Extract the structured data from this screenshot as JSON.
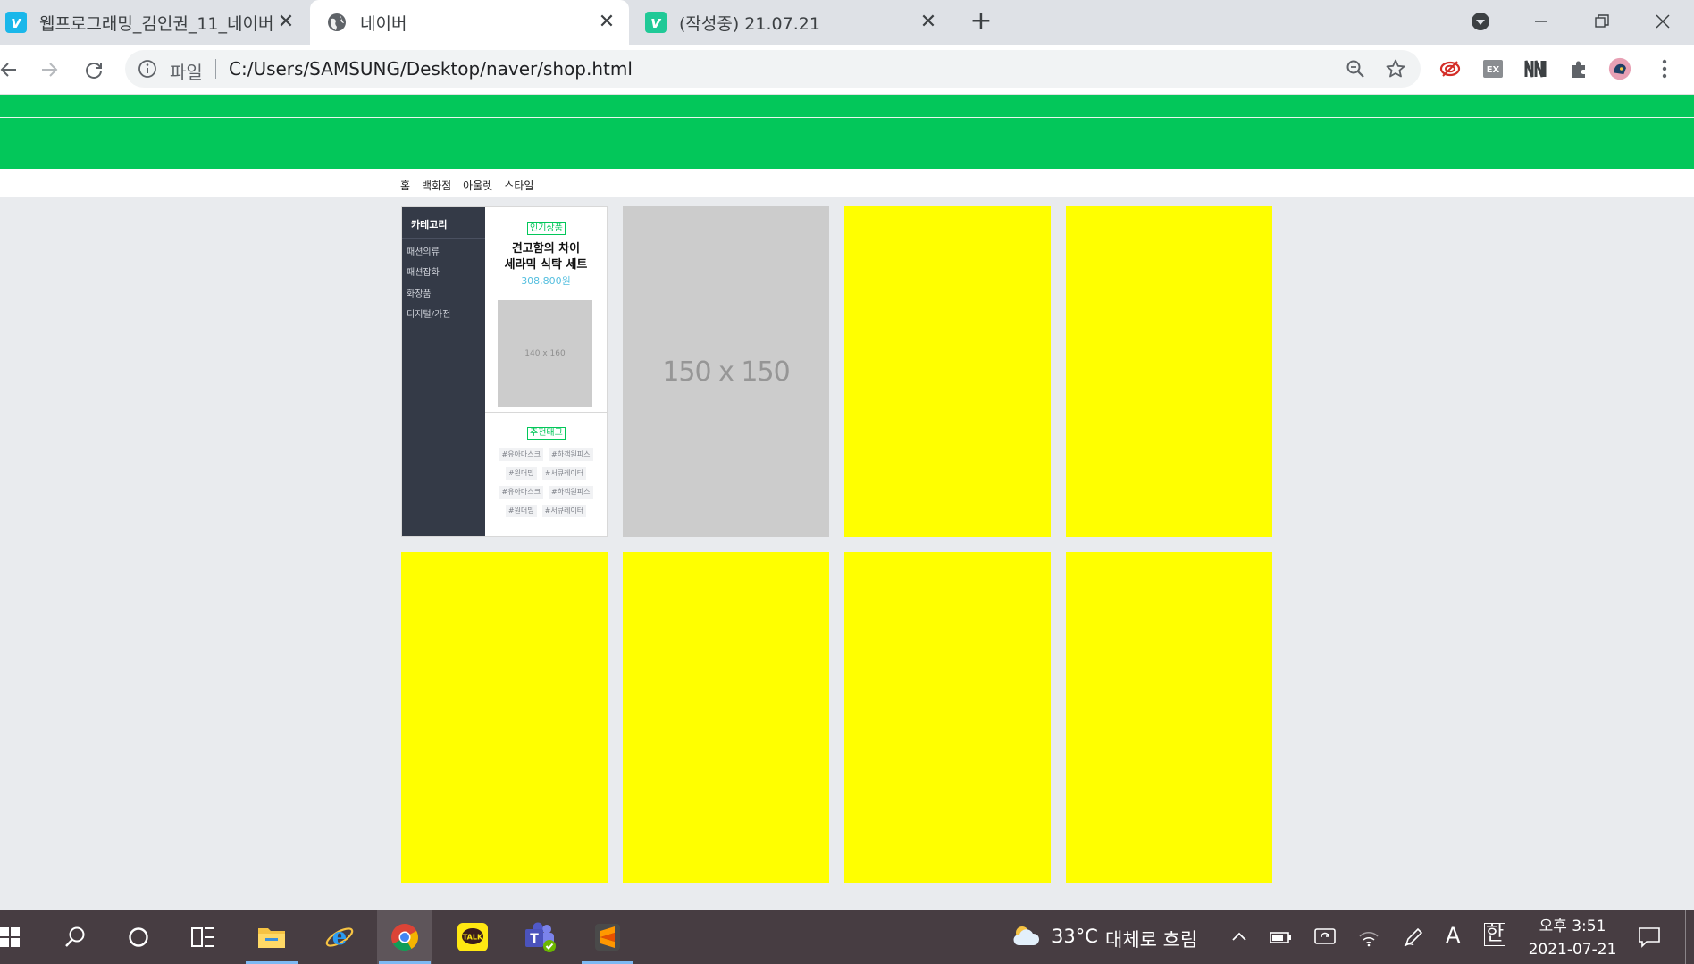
{
  "browser": {
    "tabs": [
      {
        "title": "웹프로그래밍_김인권_11_네이버",
        "favicon": "vimeo-icon",
        "color": "#1ab7ea",
        "active": false
      },
      {
        "title": "네이버",
        "favicon": "globe-icon",
        "active": true
      },
      {
        "title": "(작성중) 21.07.21",
        "favicon": "vimeo-icon",
        "color": "#20c997",
        "active": false
      }
    ],
    "address": {
      "scheme_label": "파일",
      "url": "C:/Users/SAMSUNG/Desktop/naver/shop.html"
    },
    "extensions": [
      "lastpass-icon",
      "ex-icon",
      "nn-icon",
      "puzzle-icon",
      "profile-avatar"
    ]
  },
  "page": {
    "colors": {
      "brand_green": "#03c75a",
      "tile_yellow": "#ffff00",
      "placeholder_gray": "#cccccc",
      "sidebar_dark": "#343a47",
      "price_blue": "#56bfdf"
    },
    "subnav": [
      "홈",
      "백화점",
      "아울렛",
      "스타일"
    ],
    "categories": {
      "title": "카테고리",
      "items": [
        "패션의류",
        "패션잡화",
        "화장품",
        "디지털/가전"
      ]
    },
    "product": {
      "badge": "인기상품",
      "name_line1": "견고함의 차이",
      "name_line2": "세라믹 식탁 세트",
      "price": "308,800원",
      "image_label": "140 x 160"
    },
    "tags": {
      "badge": "추천태그",
      "rows": [
        [
          "#유아마스크",
          "#하객원피스"
        ],
        [
          "#원더밍",
          "#서큐레이터"
        ],
        [
          "#유아마스크",
          "#하객원피스"
        ],
        [
          "#원더밍",
          "#서큐레이터"
        ]
      ]
    },
    "placeholder_tile": {
      "label": "150 x 150"
    }
  },
  "taskbar": {
    "weather": {
      "temp": "33°C",
      "desc": "대체로 흐림"
    },
    "ime": {
      "lang_a": "A",
      "lang_kr": "한"
    },
    "clock": {
      "time": "오후 3:51",
      "date": "2021-07-21"
    },
    "apps": [
      "start-icon",
      "search-icon",
      "cortana-icon",
      "task-view-icon",
      "file-explorer-icon",
      "internet-explorer-icon",
      "chrome-icon",
      "kakaotalk-icon",
      "teams-icon",
      "sublime-icon"
    ]
  }
}
